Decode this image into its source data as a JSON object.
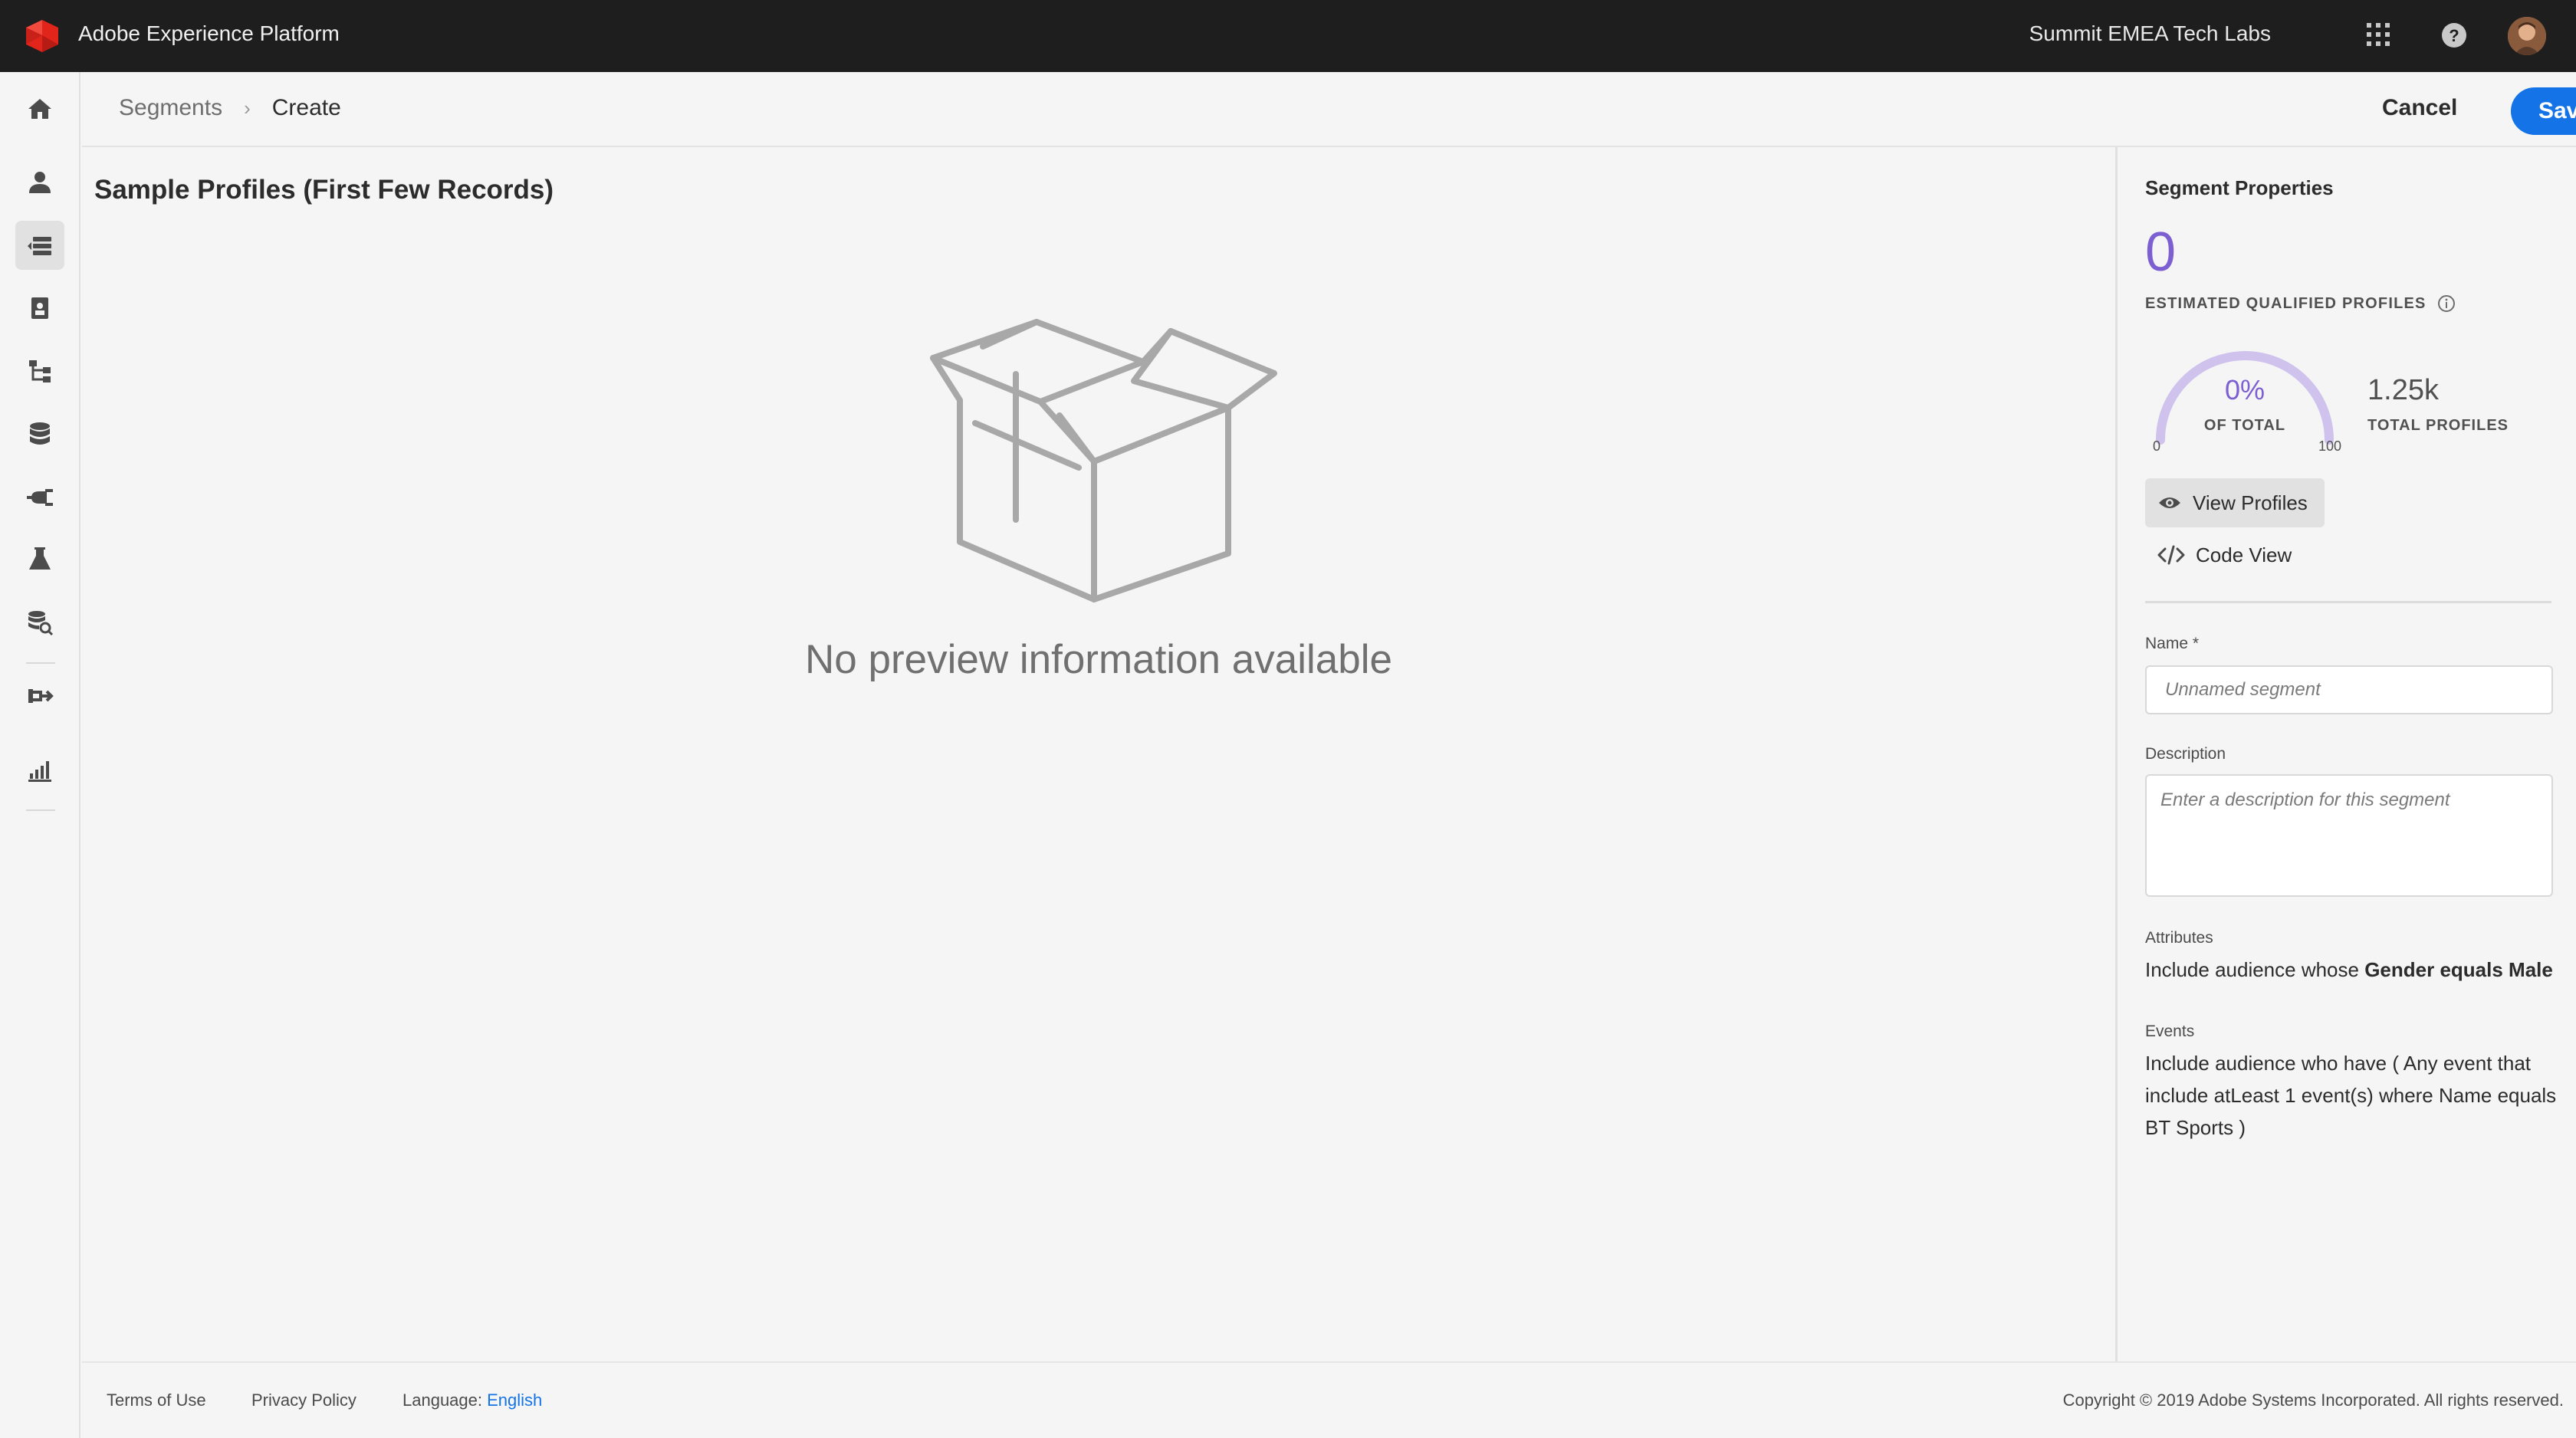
{
  "topbar": {
    "app_title": "Adobe Experience Platform",
    "org_name": "Summit EMEA Tech Labs",
    "icons": [
      "adobe-logo-icon",
      "app-switcher-grid-icon",
      "help-icon",
      "avatar"
    ]
  },
  "rail": {
    "items": [
      {
        "name": "home-icon",
        "active": false
      },
      {
        "name": "profiles-icon",
        "active": false
      },
      {
        "name": "segments-icon",
        "active": true
      },
      {
        "name": "identities-icon",
        "active": false
      },
      {
        "name": "schemas-icon",
        "active": false
      },
      {
        "name": "datasets-icon",
        "active": false
      },
      {
        "name": "sources-icon",
        "active": false
      },
      {
        "name": "notebooks-icon",
        "active": false
      },
      {
        "name": "queries-icon",
        "active": false
      },
      {
        "name": "destinations-icon",
        "active": false
      },
      {
        "name": "monitoring-icon",
        "active": false
      }
    ]
  },
  "breadcrumb": {
    "parent": "Segments",
    "current": "Create"
  },
  "actions": {
    "cancel": "Cancel",
    "save": "Save"
  },
  "main": {
    "title": "Sample Profiles (First Few Records)",
    "empty_message": "No preview information available"
  },
  "panel": {
    "title": "Segment Properties",
    "estimated_count": "0",
    "estimated_label": "ESTIMATED QUALIFIED PROFILES",
    "gauge_percent": "0%",
    "gauge_fraction": 0,
    "gauge_of_total": "OF TOTAL",
    "gauge_min": "0",
    "gauge_max": "100",
    "total_profiles": "1.25k",
    "total_label": "TOTAL PROFILES",
    "view_profiles": "View Profiles",
    "code_view": "Code View",
    "name_label": "Name *",
    "name_placeholder": "Unnamed segment",
    "description_label": "Description",
    "description_placeholder": "Enter a description for this segment",
    "attributes_label": "Attributes",
    "attributes_prefix": "Include audience whose ",
    "attributes_rule": "Gender equals Male",
    "events_label": "Events",
    "events_rule": "Include audience who have ( Any event that include atLeast 1 event(s) where Name equals BT Sports )"
  },
  "colors": {
    "accent": "#1473e6",
    "gauge": "#7c5fd1",
    "gauge_track": "#cfc3ee",
    "topbar": "#1e1e1e"
  },
  "footer": {
    "terms": "Terms of Use",
    "privacy": "Privacy Policy",
    "language_label": "Language:",
    "language_value": "English",
    "copyright": "Copyright ©  2019 Adobe Systems Incorporated.  All rights reserved."
  }
}
